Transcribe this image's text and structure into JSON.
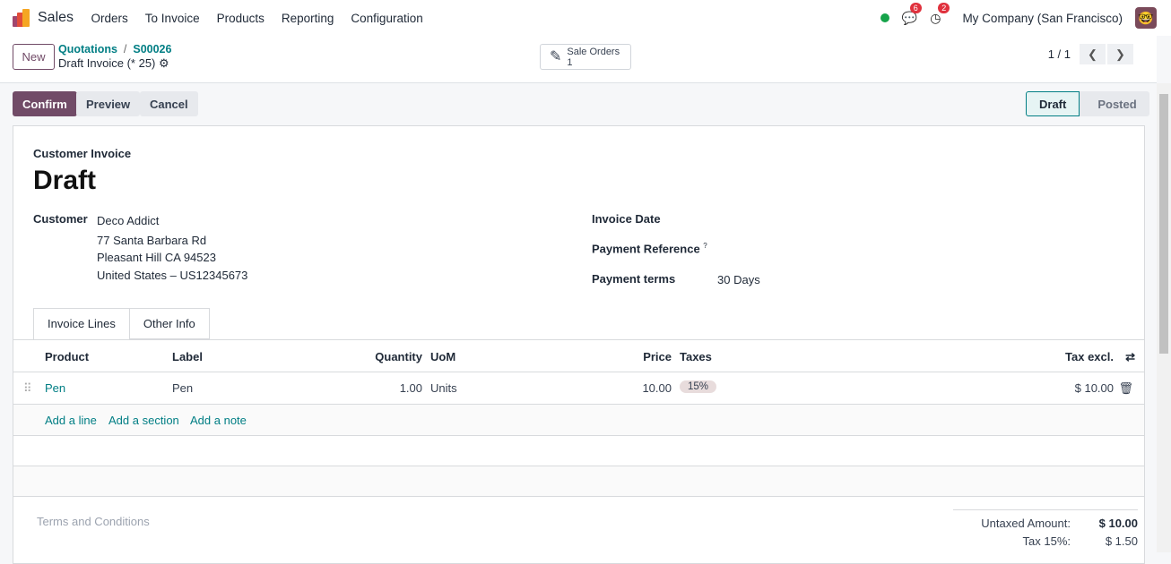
{
  "nav": {
    "app": "Sales",
    "menu": [
      "Orders",
      "To Invoice",
      "Products",
      "Reporting",
      "Configuration"
    ],
    "messages_count": "6",
    "activities_count": "2",
    "company": "My Company (San Francisco)"
  },
  "control": {
    "new": "New",
    "breadcrumb": [
      "Quotations",
      "S00026"
    ],
    "record": "Draft Invoice (* 25)",
    "smart_button": {
      "label": "Sale Orders",
      "value": "1"
    },
    "pager": "1 / 1"
  },
  "actions": {
    "confirm": "Confirm",
    "preview": "Preview",
    "cancel": "Cancel"
  },
  "statusbar": {
    "stages": [
      "Draft",
      "Posted"
    ],
    "current": "Draft"
  },
  "form": {
    "type": "Customer Invoice",
    "name": "Draft",
    "customer_label": "Customer",
    "customer": [
      "Deco Addict",
      "77 Santa Barbara Rd",
      "Pleasant Hill CA 94523",
      "United States – US12345673"
    ],
    "invoice_date_label": "Invoice Date",
    "payment_ref_label": "Payment Reference",
    "payment_ref_help": "?",
    "payment_terms_label": "Payment terms",
    "payment_terms": "30 Days"
  },
  "tabs": [
    "Invoice Lines",
    "Other Info"
  ],
  "lines": {
    "headers": [
      "Product",
      "Label",
      "Quantity",
      "UoM",
      "Price",
      "Taxes",
      "Tax excl."
    ],
    "rows": [
      {
        "product": "Pen",
        "label": "Pen",
        "quantity": "1.00",
        "uom": "Units",
        "price": "10.00",
        "taxes": "15%",
        "subtotal": "$ 10.00"
      }
    ],
    "add": [
      "Add a line",
      "Add a section",
      "Add a note"
    ]
  },
  "footer": {
    "terms_placeholder": "Terms and Conditions",
    "untaxed_label": "Untaxed Amount:",
    "untaxed": "$ 10.00",
    "tax_label": "Tax 15%:",
    "tax": "$ 1.50"
  },
  "colors": {
    "primary": "#714b67",
    "link": "#017e84"
  }
}
